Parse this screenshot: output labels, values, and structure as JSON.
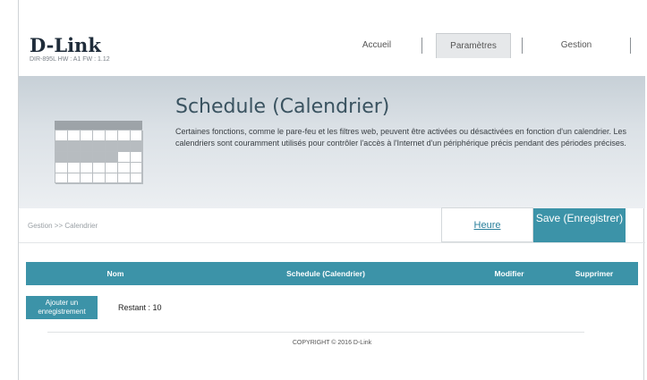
{
  "brand": {
    "logo": "D-Link",
    "device": "DIR-895L   HW : A1   FW : 1.12"
  },
  "nav": {
    "home": "Accueil",
    "settings": "Paramètres",
    "management": "Gestion"
  },
  "hero": {
    "title": "Schedule (Calendrier)",
    "description": "Certaines fonctions, comme le pare-feu et les filtres web, peuvent être activées ou désactivées en fonction d'un calendrier. Les calendriers sont couramment utilisés pour contrôler l'accès à l'Internet d'un périphérique précis pendant des périodes précises."
  },
  "breadcrumb": "Gestion >> Calendrier",
  "actions": {
    "heure": "Heure",
    "save": "Save (Enregistrer)"
  },
  "table": {
    "columns": [
      "Nom",
      "Schedule (Calendrier)",
      "Modifier",
      "Supprimer"
    ]
  },
  "add_button": "Ajouter un enregistrement",
  "remaining": "Restant : 10",
  "footer": "COPYRIGHT © 2016 D-Link",
  "colors": {
    "accent": "#3c93a8",
    "link": "#2a7f9b"
  },
  "icons": {
    "hero": "calendar-icon"
  }
}
